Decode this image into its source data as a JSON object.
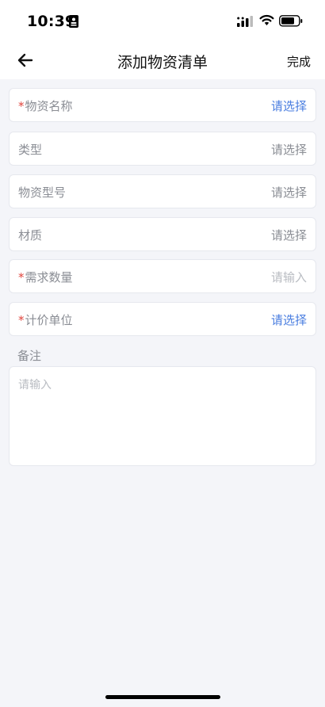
{
  "status_bar": {
    "time": "10:39",
    "icons": [
      "id-card-icon",
      "signal-icon",
      "wifi-icon",
      "battery-icon"
    ]
  },
  "nav": {
    "back_icon": "arrow-left-icon",
    "title": "添加物资清单",
    "done_label": "完成"
  },
  "form": {
    "fields": [
      {
        "label": "物资名称",
        "required": true,
        "value": "请选择",
        "value_style": "link"
      },
      {
        "label": "类型",
        "required": false,
        "value": "请选择",
        "value_style": "muted"
      },
      {
        "label": "物资型号",
        "required": false,
        "value": "请选择",
        "value_style": "muted"
      },
      {
        "label": "材质",
        "required": false,
        "value": "请选择",
        "value_style": "muted"
      },
      {
        "label": "需求数量",
        "required": true,
        "value": "请输入",
        "value_style": "faint"
      },
      {
        "label": "计价单位",
        "required": true,
        "value": "请选择",
        "value_style": "link"
      }
    ],
    "required_mark": "*",
    "remark_label": "备注",
    "remark_placeholder": "请输入"
  },
  "colors": {
    "accent": "#4a7ee0",
    "required": "#e0443c",
    "background": "#f4f5f9"
  }
}
